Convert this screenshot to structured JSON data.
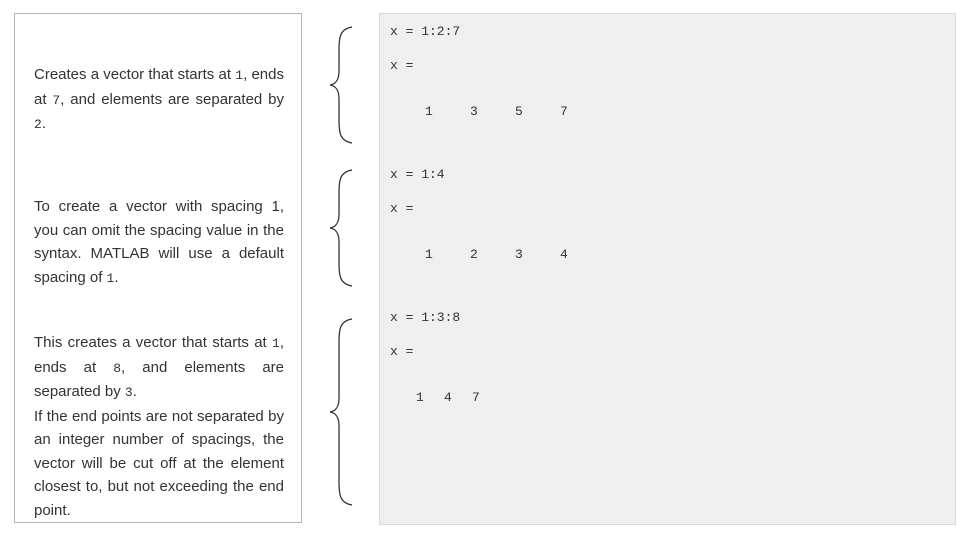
{
  "descriptions": {
    "first": {
      "t1": "Creates a vector that starts at ",
      "c1": "1",
      "t2": ", ends at ",
      "c2": "7",
      "t3": ", and elements are separated by ",
      "c3": "2",
      "t4": "."
    },
    "second": {
      "t1": "To create a vector with spacing 1, you can omit the spacing value in the syntax. MATLAB will use a default spacing of ",
      "c1": "1",
      "t2": "."
    },
    "third": {
      "t1": "This creates a vector that starts at ",
      "c1": "1",
      "t2": ", ends at ",
      "c2": "8",
      "t3": ", and elements are separated by ",
      "c3": "3",
      "t4": ".",
      "p2": "If the end points are not separated by an integer number of spacings, the vector will be cut off at the element closest to, but not exceeding the end point."
    }
  },
  "code": {
    "block1": {
      "command": "x = 1:2:7",
      "var_line": "x =",
      "values": [
        "1",
        "3",
        "5",
        "7"
      ]
    },
    "block2": {
      "command": "x = 1:4",
      "var_line": "x =",
      "values": [
        "1",
        "2",
        "3",
        "4"
      ]
    },
    "block3": {
      "command": "x = 1:3:8",
      "var_line": "x =",
      "values": [
        "1",
        "4",
        "7"
      ]
    }
  },
  "colors": {
    "code_background": "#efefef",
    "panel_border": "#b5b5b5",
    "text": "#333333"
  }
}
